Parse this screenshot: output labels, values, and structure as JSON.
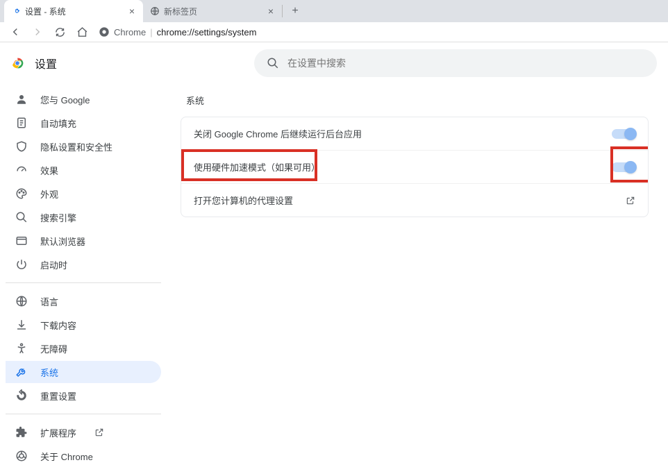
{
  "tabs": [
    {
      "title": "设置 - 系统",
      "active": true,
      "favicon": "gear-blue"
    },
    {
      "title": "新标签页",
      "active": false,
      "favicon": "globe"
    }
  ],
  "omnibox": {
    "chip": "Chrome",
    "url": "chrome://settings/system"
  },
  "settings_title": "设置",
  "search": {
    "placeholder": "在设置中搜索"
  },
  "sidebar": {
    "groups": [
      [
        {
          "icon": "person",
          "label": "您与 Google"
        },
        {
          "icon": "autofill",
          "label": "自动填充"
        },
        {
          "icon": "shield",
          "label": "隐私设置和安全性"
        },
        {
          "icon": "speed",
          "label": "效果"
        },
        {
          "icon": "palette",
          "label": "外观"
        },
        {
          "icon": "search",
          "label": "搜索引擎"
        },
        {
          "icon": "browser",
          "label": "默认浏览器"
        },
        {
          "icon": "power",
          "label": "启动时"
        }
      ],
      [
        {
          "icon": "globe",
          "label": "语言"
        },
        {
          "icon": "download",
          "label": "下载内容"
        },
        {
          "icon": "accessibility",
          "label": "无障碍"
        },
        {
          "icon": "wrench",
          "label": "系统",
          "active": true
        },
        {
          "icon": "reset",
          "label": "重置设置"
        }
      ],
      [
        {
          "icon": "extension",
          "label": "扩展程序",
          "external": true
        },
        {
          "icon": "chrome",
          "label": "关于 Chrome"
        }
      ]
    ]
  },
  "main": {
    "section_title": "系统",
    "rows": [
      {
        "label": "关闭 Google Chrome 后继续运行后台应用",
        "type": "toggle",
        "on": true,
        "highlighted": false
      },
      {
        "label": "使用硬件加速模式（如果可用）",
        "type": "toggle",
        "on": true,
        "highlighted": true
      },
      {
        "label": "打开您计算机的代理设置",
        "type": "link",
        "highlighted": false
      }
    ]
  }
}
